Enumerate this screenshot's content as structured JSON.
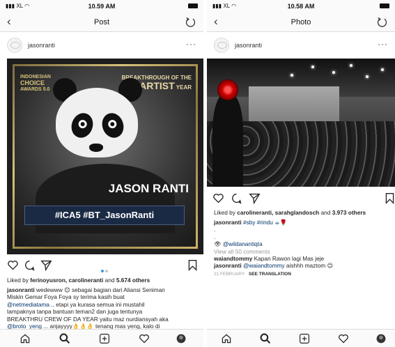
{
  "left": {
    "status": {
      "carrier": "XL",
      "time": "10.59 AM"
    },
    "nav": {
      "title": "Post"
    },
    "header": {
      "username": "jasonranti",
      "more": "···"
    },
    "image": {
      "logo_left": [
        "INDONESIAN",
        "CHOICE",
        "AWARDS",
        "5.0"
      ],
      "logo_right": [
        "BREAKTHROUGH",
        "OF THE",
        "ARTIST",
        "YEAR"
      ],
      "name": "JASON RANTI",
      "hashtags": "#ICA5 #BT_JasonRanti"
    },
    "likes": {
      "prefix": "Liked by ",
      "users": "ferinoyusron, carolineranti",
      "middle": " and ",
      "count": "5.674 others"
    },
    "caption": {
      "username": "jasonranti",
      "line1": " wedewww 😊 sebagai bagian dari Aliansi Seniman",
      "line2": "Miskin Gemar Foya Foya sy terima kasih buat",
      "mention1": "@netmediatama",
      "line3": " .. etapi ya kurasa semua ini mustahil",
      "line4": "tampaknya tanpa bantuan teman2 dan juga tentunya",
      "line5": "BREAKTHRU CREW OF DA YEAR yaitu maz nurdiansyah aka",
      "mention2": "@broto_yeng",
      "line6": " ... anjayyyy👌👌👌 tenang mas yeng, kalo di"
    }
  },
  "right": {
    "status": {
      "carrier": "XL",
      "time": "10.58 AM"
    },
    "nav": {
      "title": "Photo"
    },
    "header": {
      "username": "jasonranti",
      "more": "···"
    },
    "likes": {
      "prefix": "Liked by ",
      "users": "carolineranti, sarahglandosch",
      "middle": " and ",
      "count": "3.973 others"
    },
    "caption": {
      "username": "jasonranti",
      "tags": " #sby #rindu ☕🌹"
    },
    "dot1": ".",
    "dot2": ".",
    "credit": "@wildanantiqta",
    "view_all": "View all 50 comments",
    "comment1": {
      "username": "waiandtommy",
      "text": " Kapan Rawon lagi Mas jeje"
    },
    "comment2": {
      "username": "jasonranti",
      "mention": " @waiandtommy",
      "text": " aishhh maztom 😊"
    },
    "date": "21 FEBRUARY",
    "see_translation": "SEE TRANSLATION"
  }
}
